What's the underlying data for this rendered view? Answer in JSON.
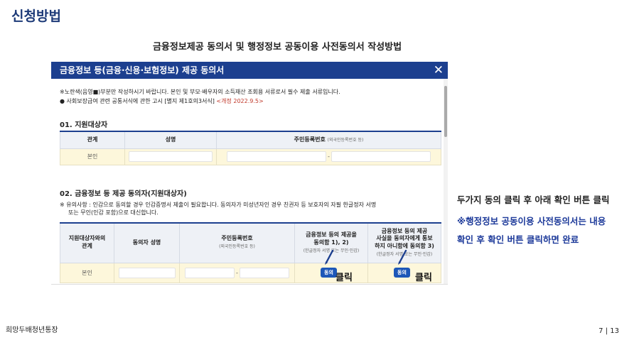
{
  "page": {
    "title": "신청방법",
    "subtitle": "금융정보제공 동의서 및 행정정보 공동이용 사전동의서 작성방법"
  },
  "window": {
    "title": "금융정보 등(금융·신용·보험정보) 제공 동의서",
    "close_glyph": "✕",
    "notice_line1": "※노란색(음영■)부분만 작성하시기 바랍니다. 본인 및 부모·배우자의 소득재산 조회용 서류로서 필수 제출 서류입니다.",
    "notice_line2": "● 사회보장급여 관련 공통서식에 관한 고시 [별지 제1호의3서식]",
    "notice_revision": "<개정 2022.9.5>",
    "section1": {
      "title": "01. 지원대상자",
      "headers": [
        "관계",
        "성명"
      ],
      "header_id": "주민등록번호",
      "header_id_note": "(외국인등록번호 등)",
      "row_relation": "본인",
      "id_dash": "-"
    },
    "section2": {
      "title": "02. 금융정보 등 제공 동의자(지원대상자)",
      "caution_line1": "※ 유의사항 : 인감으로 동의할 경우 인감증명서 제출이 필요합니다. 동의자가 미성년자인 경우 친권자 등 보호자의 자필 한글정자 서명",
      "caution_line2": "또는 무인(인감 포함)으로 대신합니다.",
      "header_relation_line1": "지원대상자와의",
      "header_relation_line2": "관계",
      "header_name": "동의자 성명",
      "header_id": "주민등록번호",
      "header_id_note": "(외국인등록번호 등)",
      "header_consent1_line1": "금융정보 등의 제공을",
      "header_consent1_line2": "동의함 1), 2)",
      "header_consent1_note": "(한글정자 서명 또는 무인·인감)",
      "header_consent2_line1": "금융정보 등의 제공",
      "header_consent2_line2": "사실을 동의자에게 통보",
      "header_consent2_line3": "하지 아니함에 동의함 3)",
      "header_consent2_note": "(한글정자 서명 또는 무인·인감)",
      "row_relation": "본인",
      "id_dash": "-",
      "agree_button_label": "동의",
      "click_label": "클릭"
    }
  },
  "side_instructions": {
    "line1": "두가지 동의 클릭 후 아래 확인 버튼 클릭",
    "line2": "※행정정보 공동이용 사전동의서는 내용",
    "line3": "확인 후 확인 버튼 클릭하면 완료"
  },
  "footer": {
    "brand": "희망두배청년통장",
    "page_indicator": "7 | 13"
  },
  "colors": {
    "title_navy": "#1d3a78",
    "header_blue": "#1c3f8f",
    "button_blue": "#1c57b8",
    "input_yellow": "#fdf7db",
    "revision_red": "#c0392b"
  },
  "icons": {
    "close": "close-icon",
    "pointer": "pen-pointer-icon"
  }
}
